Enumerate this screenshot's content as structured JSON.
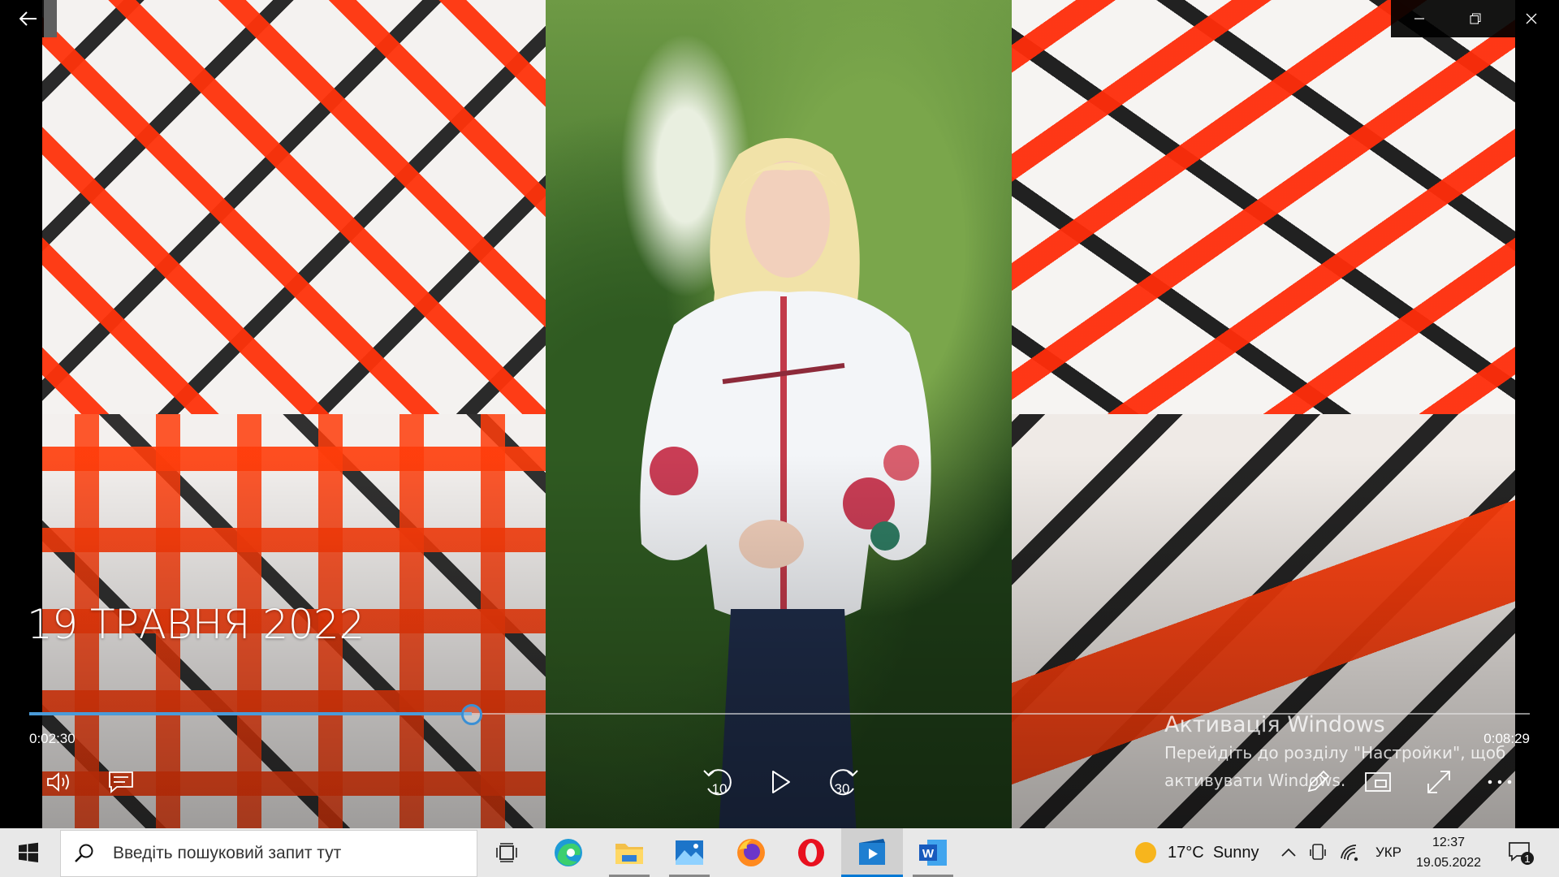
{
  "video": {
    "title": "19 ТРАВНЯ 2022"
  },
  "player": {
    "elapsed": "0:02:30",
    "total": "0:08:29",
    "progress_fraction": 0.2947,
    "rewind_label": "10",
    "forward_label": "30",
    "accent_color": "#3b8fd4"
  },
  "activation": {
    "title": "Активація Windows",
    "line1": "Перейдіть до розділу \"Настройки\", щоб",
    "line2": "активувати Windows."
  },
  "taskbar": {
    "search_placeholder": "Введіть пошуковий запит тут",
    "weather_temp": "17°C",
    "weather_text": "Sunny",
    "language": "УКР",
    "time": "12:37",
    "date": "19.05.2022",
    "notification_count": "1",
    "apps": [
      "task-view",
      "edge",
      "file-explorer",
      "photos",
      "firefox",
      "opera",
      "movies-tv",
      "word"
    ]
  }
}
